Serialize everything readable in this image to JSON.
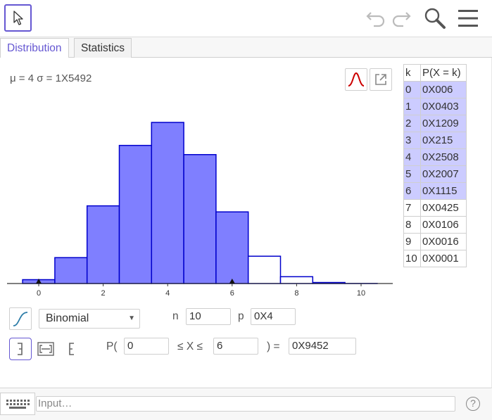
{
  "toolbar": {
    "move_tool_icon": "cursor-arrow-icon",
    "undo_icon": "undo-icon",
    "redo_icon": "redo-icon",
    "search_icon": "search-icon",
    "menu_icon": "hamburger-menu-icon"
  },
  "tabs": [
    {
      "label": "Distribution",
      "active": true
    },
    {
      "label": "Statistics",
      "active": false
    }
  ],
  "distribution": {
    "parameters_text": "μ = 4 σ = 1X5492",
    "type": "Binomial",
    "n_label": "n",
    "n_value": "10",
    "p_label": "p",
    "p_value": "0X4",
    "prob_prefix": "P(",
    "lower_bound": "0",
    "between_label": "≤ X ≤",
    "upper_bound": "6",
    "result_label": ") =",
    "result_value": "0X9452"
  },
  "table": {
    "headers": [
      "k",
      "P(X = k)"
    ],
    "rows": [
      {
        "k": "0",
        "p": "0X006",
        "selected": true
      },
      {
        "k": "1",
        "p": "0X0403",
        "selected": true
      },
      {
        "k": "2",
        "p": "0X1209",
        "selected": true
      },
      {
        "k": "3",
        "p": "0X215",
        "selected": true
      },
      {
        "k": "4",
        "p": "0X2508",
        "selected": true
      },
      {
        "k": "5",
        "p": "0X2007",
        "selected": true
      },
      {
        "k": "6",
        "p": "0X1115",
        "selected": true
      },
      {
        "k": "7",
        "p": "0X0425",
        "selected": false
      },
      {
        "k": "8",
        "p": "0X0106",
        "selected": false
      },
      {
        "k": "9",
        "p": "0X0016",
        "selected": false
      },
      {
        "k": "10",
        "p": "0X0001",
        "selected": false
      }
    ]
  },
  "input_bar": {
    "placeholder": "Input…",
    "keyboard_icon": "keyboard-icon",
    "help_icon": "help-icon",
    "help_symbol": "?"
  },
  "colors": {
    "accent": "#6557d2",
    "bar_fill_selected": "#7f7fff",
    "bar_stroke": "#0000cc",
    "normal_curve": "#cc0000"
  },
  "chart_data": {
    "type": "bar",
    "x": [
      0,
      1,
      2,
      3,
      4,
      5,
      6,
      7,
      8,
      9,
      10
    ],
    "values": [
      0.006,
      0.0403,
      0.1209,
      0.215,
      0.2508,
      0.2007,
      0.1115,
      0.0425,
      0.0106,
      0.0016,
      0.0001
    ],
    "selected_range": [
      0,
      6
    ],
    "xticks": [
      "0",
      "2",
      "4",
      "6",
      "8",
      "10"
    ],
    "xlim": [
      -1,
      11
    ],
    "title": "",
    "xlabel": "",
    "ylabel": ""
  }
}
